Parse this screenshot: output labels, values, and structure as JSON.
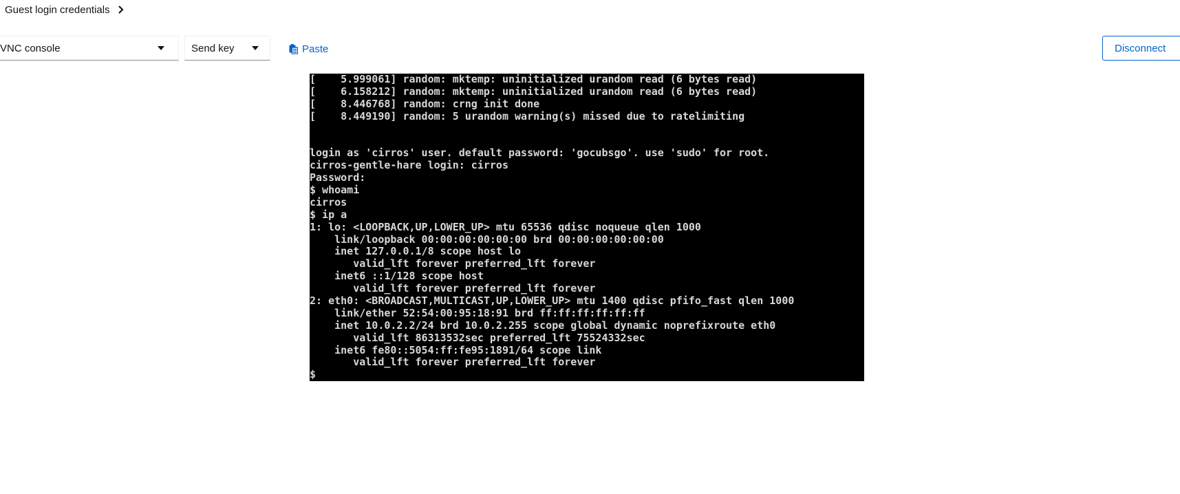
{
  "header": {
    "guest_login_label": "Guest login credentials"
  },
  "toolbar": {
    "console_type": "VNC console",
    "send_key_label": "Send key",
    "paste_label": "Paste",
    "disconnect_label": "Disconnect"
  },
  "icons": {
    "chevron": "chevron-right-icon",
    "caret": "caret-down-icon",
    "paste": "paste-icon"
  },
  "colors": {
    "link": "#0066cc",
    "console_bg": "#000000",
    "console_text": "#d8d8d8"
  },
  "console": {
    "lines": [
      "[    5.999061] random: mktemp: uninitialized urandom read (6 bytes read)",
      "[    6.158212] random: mktemp: uninitialized urandom read (6 bytes read)",
      "[    8.446768] random: crng init done",
      "[    8.449190] random: 5 urandom warning(s) missed due to ratelimiting",
      "",
      "",
      "login as 'cirros' user. default password: 'gocubsgo'. use 'sudo' for root.",
      "cirros-gentle-hare login: cirros",
      "Password:",
      "$ whoami",
      "cirros",
      "$ ip a",
      "1: lo: <LOOPBACK,UP,LOWER_UP> mtu 65536 qdisc noqueue qlen 1000",
      "    link/loopback 00:00:00:00:00:00 brd 00:00:00:00:00:00",
      "    inet 127.0.0.1/8 scope host lo",
      "       valid_lft forever preferred_lft forever",
      "    inet6 ::1/128 scope host",
      "       valid_lft forever preferred_lft forever",
      "2: eth0: <BROADCAST,MULTICAST,UP,LOWER_UP> mtu 1400 qdisc pfifo_fast qlen 1000",
      "    link/ether 52:54:00:95:18:91 brd ff:ff:ff:ff:ff:ff",
      "    inet 10.0.2.2/24 brd 10.0.2.255 scope global dynamic noprefixroute eth0",
      "       valid_lft 86313532sec preferred_lft 75524332sec",
      "    inet6 fe80::5054:ff:fe95:1891/64 scope link",
      "       valid_lft forever preferred_lft forever",
      "$"
    ]
  }
}
